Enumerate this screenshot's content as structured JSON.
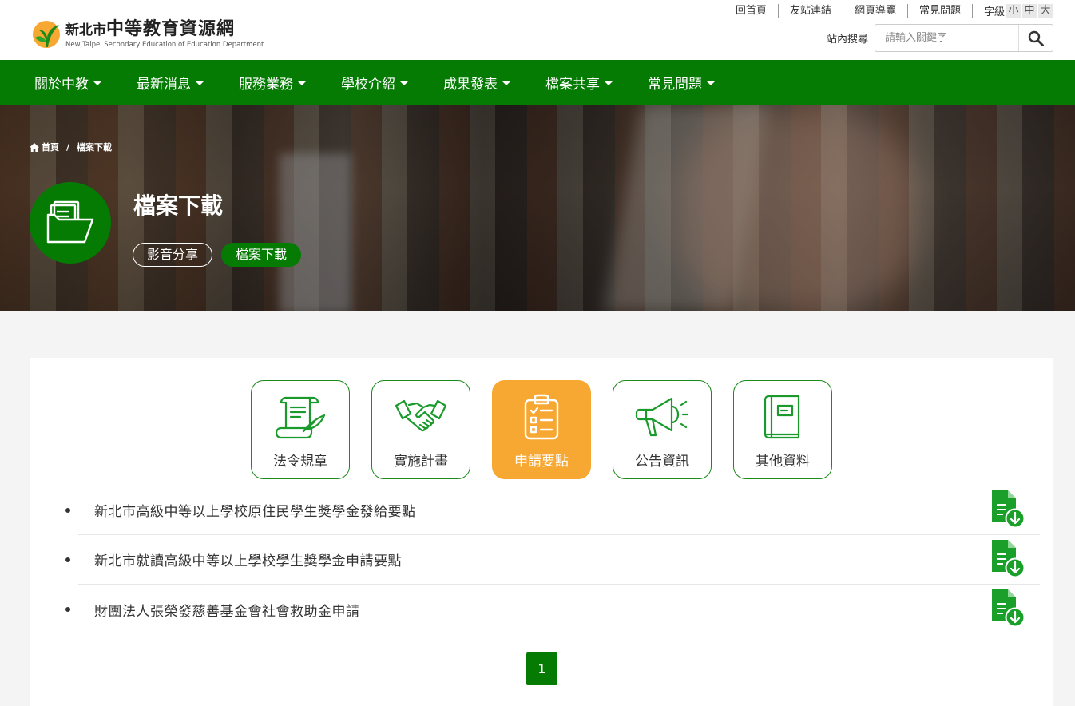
{
  "site": {
    "title": "新北市中等教育資源網",
    "title_prefix": "新北市",
    "title_main": "中等教育資源網",
    "subtitle": "New Taipei Secondary Education of Education Department"
  },
  "toplinks": [
    "回首頁",
    "友站連結",
    "網頁導覽",
    "常見問題"
  ],
  "fontsize": {
    "label": "字級",
    "options": [
      "小",
      "中",
      "大"
    ]
  },
  "search": {
    "label": "站內搜尋",
    "placeholder": "請輸入關鍵字"
  },
  "nav": [
    "關於中教",
    "最新消息",
    "服務業務",
    "學校介紹",
    "成果發表",
    "檔案共享",
    "常見問題"
  ],
  "breadcrumb": {
    "home": "首頁",
    "current": "檔案下載"
  },
  "page": {
    "title": "檔案下載",
    "subtabs": [
      "影音分享",
      "檔案下載"
    ],
    "active_subtab": "檔案下載"
  },
  "categories": [
    {
      "label": "法令規章",
      "icon": "scroll-quill-icon"
    },
    {
      "label": "實施計畫",
      "icon": "handshake-icon"
    },
    {
      "label": "申請要點",
      "icon": "clipboard-checklist-icon"
    },
    {
      "label": "公告資訊",
      "icon": "megaphone-icon"
    },
    {
      "label": "其他資料",
      "icon": "book-icon"
    }
  ],
  "active_category": "申請要點",
  "files": [
    "新北市高級中等以上學校原住民學生獎學金發給要點",
    "新北市就讀高級中等以上學校學生獎學金申請要點",
    "財團法人張榮發慈善基金會社會救助金申請"
  ],
  "pagination": {
    "current": "1"
  },
  "colors": {
    "brand_green": "#057b04",
    "active_orange": "#f7a832"
  }
}
